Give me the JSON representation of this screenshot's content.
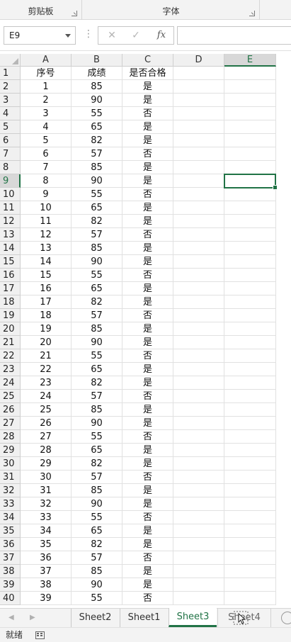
{
  "ribbon": {
    "groups": [
      "剪贴板",
      "字体"
    ]
  },
  "formula_bar": {
    "name_box": "E9",
    "cancel_icon": "close-icon",
    "confirm_icon": "check-icon",
    "fx_label": "fx",
    "formula_value": ""
  },
  "sheet": {
    "columns": [
      "A",
      "B",
      "C",
      "D",
      "E"
    ],
    "active_column": "E",
    "active_row": 9,
    "rows": [
      {
        "n": "1",
        "a": "序号",
        "b": "成绩",
        "c": "是否合格"
      },
      {
        "n": "2",
        "a": "1",
        "b": "85",
        "c": "是"
      },
      {
        "n": "3",
        "a": "2",
        "b": "90",
        "c": "是"
      },
      {
        "n": "4",
        "a": "3",
        "b": "55",
        "c": "否"
      },
      {
        "n": "5",
        "a": "4",
        "b": "65",
        "c": "是"
      },
      {
        "n": "6",
        "a": "5",
        "b": "82",
        "c": "是"
      },
      {
        "n": "7",
        "a": "6",
        "b": "57",
        "c": "否"
      },
      {
        "n": "8",
        "a": "7",
        "b": "85",
        "c": "是"
      },
      {
        "n": "9",
        "a": "8",
        "b": "90",
        "c": "是"
      },
      {
        "n": "10",
        "a": "9",
        "b": "55",
        "c": "否"
      },
      {
        "n": "11",
        "a": "10",
        "b": "65",
        "c": "是"
      },
      {
        "n": "12",
        "a": "11",
        "b": "82",
        "c": "是"
      },
      {
        "n": "13",
        "a": "12",
        "b": "57",
        "c": "否"
      },
      {
        "n": "14",
        "a": "13",
        "b": "85",
        "c": "是"
      },
      {
        "n": "15",
        "a": "14",
        "b": "90",
        "c": "是"
      },
      {
        "n": "16",
        "a": "15",
        "b": "55",
        "c": "否"
      },
      {
        "n": "17",
        "a": "16",
        "b": "65",
        "c": "是"
      },
      {
        "n": "18",
        "a": "17",
        "b": "82",
        "c": "是"
      },
      {
        "n": "19",
        "a": "18",
        "b": "57",
        "c": "否"
      },
      {
        "n": "20",
        "a": "19",
        "b": "85",
        "c": "是"
      },
      {
        "n": "21",
        "a": "20",
        "b": "90",
        "c": "是"
      },
      {
        "n": "22",
        "a": "21",
        "b": "55",
        "c": "否"
      },
      {
        "n": "23",
        "a": "22",
        "b": "65",
        "c": "是"
      },
      {
        "n": "24",
        "a": "23",
        "b": "82",
        "c": "是"
      },
      {
        "n": "25",
        "a": "24",
        "b": "57",
        "c": "否"
      },
      {
        "n": "26",
        "a": "25",
        "b": "85",
        "c": "是"
      },
      {
        "n": "27",
        "a": "26",
        "b": "90",
        "c": "是"
      },
      {
        "n": "28",
        "a": "27",
        "b": "55",
        "c": "否"
      },
      {
        "n": "29",
        "a": "28",
        "b": "65",
        "c": "是"
      },
      {
        "n": "30",
        "a": "29",
        "b": "82",
        "c": "是"
      },
      {
        "n": "31",
        "a": "30",
        "b": "57",
        "c": "否"
      },
      {
        "n": "32",
        "a": "31",
        "b": "85",
        "c": "是"
      },
      {
        "n": "33",
        "a": "32",
        "b": "90",
        "c": "是"
      },
      {
        "n": "34",
        "a": "33",
        "b": "55",
        "c": "否"
      },
      {
        "n": "35",
        "a": "34",
        "b": "65",
        "c": "是"
      },
      {
        "n": "36",
        "a": "35",
        "b": "82",
        "c": "是"
      },
      {
        "n": "37",
        "a": "36",
        "b": "57",
        "c": "否"
      },
      {
        "n": "38",
        "a": "37",
        "b": "85",
        "c": "是"
      },
      {
        "n": "39",
        "a": "38",
        "b": "90",
        "c": "是"
      },
      {
        "n": "40",
        "a": "39",
        "b": "55",
        "c": "否"
      }
    ]
  },
  "tabs": {
    "items": [
      "Sheet2",
      "Sheet1",
      "Sheet3",
      "Sheet4"
    ],
    "active": "Sheet3",
    "dragging": "Sheet4"
  },
  "status": {
    "text": "就绪",
    "icon": "macro-record-icon"
  },
  "colors": {
    "accent": "#217346"
  }
}
